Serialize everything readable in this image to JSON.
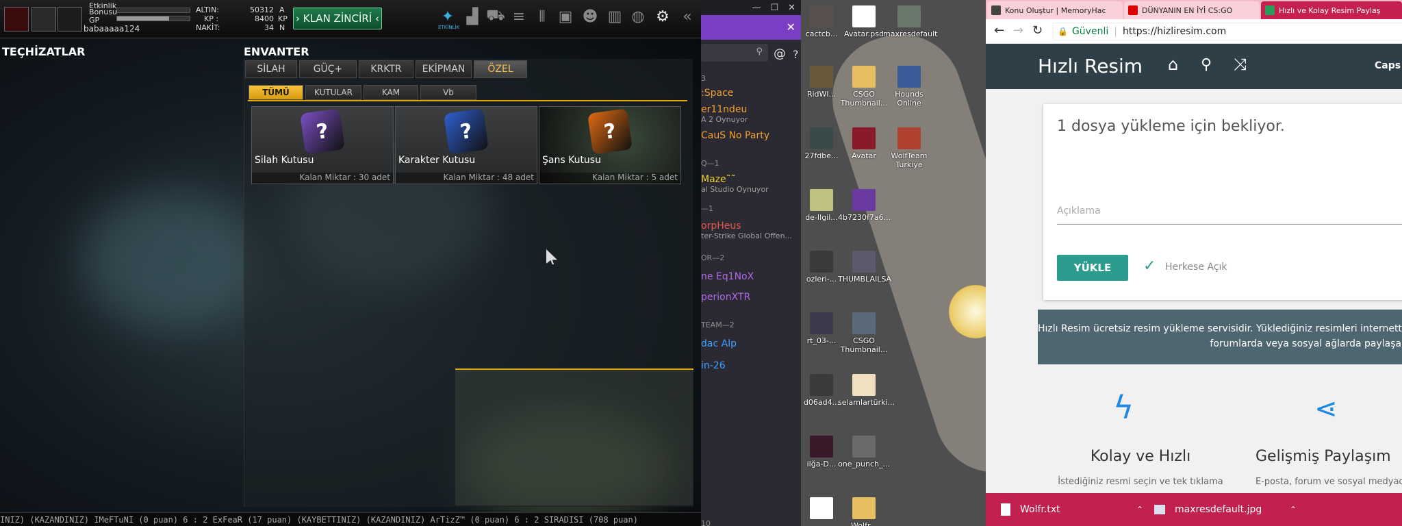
{
  "game": {
    "hud": {
      "etkinlik_label": "Etkinlik",
      "bonusu_label": "Bonusu",
      "gp_label": "GP",
      "username": "babaaaaa124",
      "altin_label": "ALTIN:",
      "altin_value": "50312",
      "altin_unit": "A",
      "kp_label": "KP :",
      "kp_value": "8400",
      "kp_unit": "KP",
      "nakit_label": "NAKİT:",
      "nakit_value": "34",
      "nakit_unit": "N",
      "clan_button": "› KLAN ZİNCİRİ ‹",
      "etkinlik_icon_label": "ETKİNLİK",
      "bonus_fill": 0.0,
      "gp_fill": 0.72
    },
    "left_title": "TEÇHİZATLAR",
    "right_title": "ENVANTER",
    "tabs": [
      "SİLAH",
      "GÜÇ+",
      "KRKTR",
      "EKİPMAN",
      "ÖZEL"
    ],
    "active_tab": 4,
    "subtabs": [
      "TÜMÜ",
      "KUTULAR",
      "KAM",
      "Vb"
    ],
    "active_subtab": 0,
    "items": [
      {
        "name": "Silah Kutusu",
        "qty": "Kalan Miktar : 30 adet",
        "color": "#7b4fc4"
      },
      {
        "name": "Karakter Kutusu",
        "qty": "Kalan Miktar : 48 adet",
        "color": "#2f5fd0"
      },
      {
        "name": "Şans Kutusu",
        "qty": "Kalan Miktar : 5 adet",
        "color": "#e06a12"
      }
    ],
    "ticker": "INIZ)     (KAZANDINIZ) IMeFTuNI (0 puan) 6 : 2 ExFeaR (17 puan) (KAYBETTINIZ)          (KAZANDINIZ) ArTizZ™ (0 puan) 6 : 2 SIRADISI (708 puan)"
  },
  "chat": {
    "lines": [
      {
        "text": "3",
        "color": "#8e8e8e"
      },
      {
        "text": ":Space",
        "color": "#f0a030"
      },
      {
        "text": "er11ndeu",
        "color": "#f0a030"
      },
      {
        "text": "A 2 Oynuyor",
        "color": "#a0a0a0"
      },
      {
        "text": "CauS No Party",
        "color": "#f0a030"
      },
      {
        "text": "Q—1",
        "color": "#8e8e8e"
      },
      {
        "text": "Maze˜˜",
        "color": "#f0d030"
      },
      {
        "text": "al Studio Oynuyor",
        "color": "#a0a0a0"
      },
      {
        "text": "—1",
        "color": "#8e8e8e"
      },
      {
        "text": "orpHeus",
        "color": "#e8574a"
      },
      {
        "text": "ter-Strike Global Offen...",
        "color": "#a0a0a0"
      },
      {
        "text": "OR—2",
        "color": "#8e8e8e"
      },
      {
        "text": "ne Eq1NoX",
        "color": "#b06ae8"
      },
      {
        "text": "perionXTR",
        "color": "#b06ae8"
      },
      {
        "text": "TEAM—2",
        "color": "#8e8e8e"
      },
      {
        "text": "dac Alp",
        "color": "#3da0ff"
      },
      {
        "text": "in-26",
        "color": "#3da0ff"
      },
      {
        "text": "10",
        "color": "#8e8e8e"
      }
    ]
  },
  "desktop": {
    "icons": [
      {
        "label": "cactcb...",
        "color": "#5a5050"
      },
      {
        "label": "Avatar.psd",
        "color": "#ffffff"
      },
      {
        "label": "maxresdefault",
        "color": "#6a7a6a"
      },
      {
        "label": "RidWI...",
        "color": "#6a5a3a"
      },
      {
        "label": "CSGO Thumbnail...",
        "color": "#e6c060"
      },
      {
        "label": "Hounds Online",
        "color": "#3a5a9a"
      },
      {
        "label": "27fdbe...",
        "color": "#3a4a4a"
      },
      {
        "label": "Avatar",
        "color": "#8a1a2a"
      },
      {
        "label": "WolfTeam Turkiye",
        "color": "#b04030"
      },
      {
        "label": "de-Ilgil...",
        "color": "#c0c080"
      },
      {
        "label": "4b7230f7a6...",
        "color": "#6a3aa0"
      },
      {
        "label": "",
        "color": "#4e4e4e"
      },
      {
        "label": "ozleri-...",
        "color": "#3a3a3a"
      },
      {
        "label": "THUMBLAILSA",
        "color": "#5a5a6a"
      },
      {
        "label": "",
        "color": "#4e4e4e"
      },
      {
        "label": "rt_03-...",
        "color": "#3a3a4a"
      },
      {
        "label": "CSGO Thumbnail...",
        "color": "#5a6a7a"
      },
      {
        "label": "",
        "color": "#4e4e4e"
      },
      {
        "label": "d06ad4...",
        "color": "#3a3a3a"
      },
      {
        "label": "selamlartürki...",
        "color": "#f0e0c0"
      },
      {
        "label": "",
        "color": "#4e4e4e"
      },
      {
        "label": "ilğa-D...",
        "color": "#3a1a2a"
      },
      {
        "label": "one_punch_...",
        "color": "#6a6a6a"
      },
      {
        "label": "",
        "color": "#4e4e4e"
      },
      {
        "label": "",
        "color": "#ffffff"
      },
      {
        "label": "Wolfr...",
        "color": "#e6c060"
      }
    ]
  },
  "browser": {
    "tabs": [
      {
        "title": "Konu Oluştur | MemoryHac",
        "fav": "#444"
      },
      {
        "title": "DÜNYANIN EN İYİ CS:GO",
        "fav": "#d00"
      },
      {
        "title": "Hızlı ve Kolay Resim Paylaş",
        "fav": "#2a9d5c"
      }
    ],
    "active_tab": 2,
    "secure_label": "Güvenli",
    "url": "https://hizliresim.com",
    "site_title": "Hızlı Resim",
    "caps_label": "Caps V",
    "upload_waiting": "1 dosya yükleme için bekliyor.",
    "description_placeholder": "Açıklama",
    "upload_button": "YÜKLE",
    "public_label": "Herkese Açık",
    "info_line1": "Hızlı Resim ücretsiz resim yükleme servisidir. Yüklediğiniz resimleri internette",
    "info_line2": "forumlarda veya sosyal ağlarda paylaşab",
    "feature1_title": "Kolay ve Hızlı",
    "feature1_desc": "İstediğiniz resmi seçin ve tek tıklama",
    "feature2_title": "Gelişmiş Paylaşım",
    "feature2_desc": "E-posta, forum ve sosyal medyada",
    "downloads": [
      {
        "name": "Wolfr.txt"
      },
      {
        "name": "maxresdefault.jpg"
      }
    ],
    "accent": "#2a9d8f"
  }
}
